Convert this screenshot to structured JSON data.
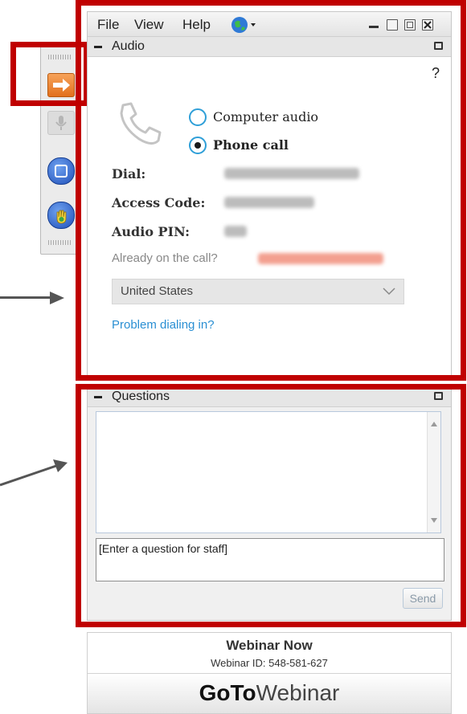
{
  "menu": {
    "file": "File",
    "view": "View",
    "help": "Help"
  },
  "audio": {
    "section_title": "Audio",
    "help_mark": "?",
    "computer_audio_label": "Computer audio",
    "phone_call_label": "Phone call",
    "selected_option": "Phone call",
    "dial_label": "Dial:",
    "access_code_label": "Access Code:",
    "audio_pin_label": "Audio PIN:",
    "already_on_call": "Already on the call?",
    "country": "United States",
    "problem_link": "Problem dialing in?"
  },
  "questions": {
    "section_title": "Questions",
    "input_placeholder": "[Enter a question for staff]",
    "send_label": "Send"
  },
  "footer": {
    "webinar_name": "Webinar Now",
    "webinar_id": "Webinar ID: 548-581-627",
    "brand_bold": "GoTo",
    "brand_light": "Webinar"
  },
  "colors": {
    "highlight": "#c00000",
    "radio_ring": "#2f9fd8",
    "link": "#2a8fd3",
    "blurred_link": "#f08070"
  },
  "icons": [
    "arrow-right-icon",
    "microphone-icon",
    "screen-icon",
    "raise-hand-icon",
    "globe-icon",
    "phone-handset-icon",
    "minimize-icon",
    "maximize-icon",
    "restore-icon",
    "close-icon",
    "chevron-down-icon",
    "popout-icon"
  ]
}
